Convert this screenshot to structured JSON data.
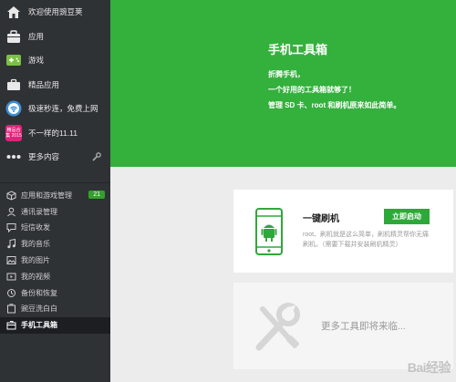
{
  "sidebar": {
    "top_items": [
      {
        "label": "欢迎使用豌豆荚",
        "icon": "home-icon"
      },
      {
        "label": "应用",
        "icon": "bag-icon"
      },
      {
        "label": "游戏",
        "icon": "gamepad-icon"
      },
      {
        "label": "精品应用",
        "icon": "briefcase-icon"
      },
      {
        "label": "极速秒连，免费上网",
        "icon": "wifi-icon"
      },
      {
        "label": "不一样的11.11",
        "icon": "promo-icon",
        "icon_text": "精品合集 2015"
      },
      {
        "label": "更多内容",
        "icon": "more-dots-icon"
      }
    ],
    "bottom_items": [
      {
        "label": "应用和游戏管理",
        "icon": "cube-icon",
        "badge": "21"
      },
      {
        "label": "通讯录管理",
        "icon": "contact-icon"
      },
      {
        "label": "短信收发",
        "icon": "message-icon"
      },
      {
        "label": "我的音乐",
        "icon": "music-icon"
      },
      {
        "label": "我的图片",
        "icon": "picture-icon"
      },
      {
        "label": "我的视频",
        "icon": "video-icon"
      },
      {
        "label": "备份和恢复",
        "icon": "backup-icon"
      },
      {
        "label": "豌豆洗白白",
        "icon": "clean-icon"
      },
      {
        "label": "手机工具箱",
        "icon": "toolbox-icon"
      }
    ]
  },
  "hero": {
    "title": "手机工具箱",
    "line1": "折腾手机，",
    "line2": "一个好用的工具箱就够了！",
    "line3": "管理 SD 卡、root 和刷机原来如此简单。"
  },
  "card_flash": {
    "title": "一键刷机",
    "button": "立即启动",
    "desc": "root、刷机就是这么简单，刷机精灵帮你无痛刷机。（需要下载并安装刷机精灵）"
  },
  "card_more": {
    "text": "更多工具即将来临..."
  },
  "watermark": "Bai经验",
  "colors": {
    "sidebar": "#2f3235",
    "hero": "#34b03d",
    "button": "#2fa83a",
    "badge": "#33a02c"
  }
}
